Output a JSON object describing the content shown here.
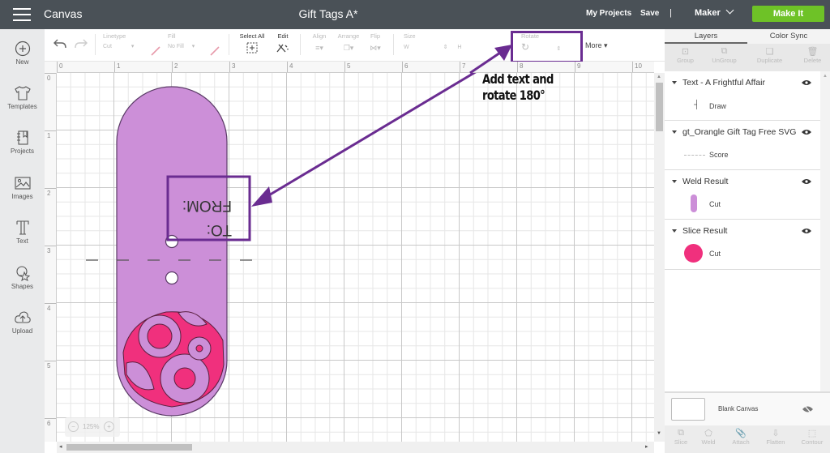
{
  "topbar": {
    "app_name": "Canvas",
    "doc_title": "Gift Tags A*",
    "my_projects": "My Projects",
    "save": "Save",
    "separator": "|",
    "machine": "Maker",
    "make_it": "Make It",
    "make_it_color": "#6ec227"
  },
  "leftbar": {
    "items": [
      {
        "label": "New",
        "icon": "plus-circle-icon"
      },
      {
        "label": "Templates",
        "icon": "tshirt-icon"
      },
      {
        "label": "Projects",
        "icon": "notebook-icon"
      },
      {
        "label": "Images",
        "icon": "image-icon"
      },
      {
        "label": "Text",
        "icon": "text-t-icon"
      },
      {
        "label": "Shapes",
        "icon": "shapes-icon"
      },
      {
        "label": "Upload",
        "icon": "cloud-upload-icon"
      }
    ]
  },
  "toolbar": {
    "linetype_label": "Linetype",
    "linetype_value": "Cut",
    "fill_label": "Fill",
    "fill_value": "No Fill",
    "select_all": "Select All",
    "edit": "Edit",
    "align": "Align",
    "arrange": "Arrange",
    "flip": "Flip",
    "size": "Size",
    "size_w": "W",
    "size_h": "H",
    "rotate": "Rotate",
    "more": "More"
  },
  "rulers": {
    "top": [
      "0",
      "1",
      "2",
      "3",
      "4",
      "5",
      "6",
      "7",
      "8",
      "9",
      "10"
    ],
    "left": [
      "0",
      "1",
      "2",
      "3",
      "4",
      "5",
      "6"
    ]
  },
  "canvas": {
    "tag_text_line1": "TO:",
    "tag_text_line2": "FROM:",
    "tag_fill": "#cc8fd8",
    "flower_fill": "#f0307d",
    "annotation_color": "#6a2c91",
    "annotation_line1": "Add text and",
    "annotation_line2": "rotate 180°",
    "zoom_level": "125%"
  },
  "rightpanel": {
    "tabs": [
      "Layers",
      "Color Sync"
    ],
    "actions": [
      "Group",
      "UnGroup",
      "Duplicate",
      "Delete"
    ],
    "layers": [
      {
        "title": "Text - A Frightful Affair",
        "sub": "Draw"
      },
      {
        "title": "gt_Orangle Gift Tag Free SVG",
        "sub": "Score"
      },
      {
        "title": "Weld Result",
        "sub": "Cut",
        "swatch": "#cc8fd8"
      },
      {
        "title": "Slice Result",
        "sub": "Cut",
        "swatch": "#f0307d"
      }
    ],
    "blank_canvas": "Blank Canvas",
    "bottom_actions": [
      "Slice",
      "Weld",
      "Attach",
      "Flatten",
      "Contour"
    ]
  }
}
